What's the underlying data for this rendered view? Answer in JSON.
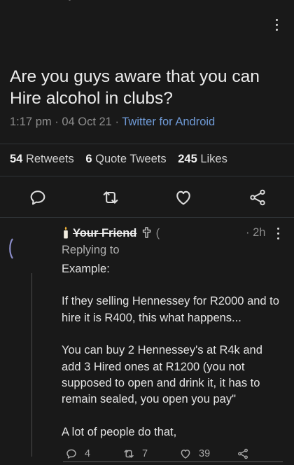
{
  "tweet": {
    "text": "Are you guys aware that you can Hire alcohol in clubs?",
    "time": "1:17 pm",
    "date": "04 Oct 21",
    "source": "Twitter for Android",
    "separator": "·"
  },
  "stats": {
    "retweets_count": "54",
    "retweets_label": "Retweets",
    "quotes_count": "6",
    "quotes_label": "Quote Tweets",
    "likes_count": "245",
    "likes_label": "Likes"
  },
  "icons": {
    "reply": "speech-bubble-icon",
    "retweet": "retweet-icon",
    "like": "heart-icon",
    "share": "share-icon",
    "more": "kebab-menu-icon",
    "candle": "candle-emoji",
    "cross": "cross-emoji"
  },
  "reply": {
    "name": "Your Friend",
    "name_suffix": "(",
    "time": "· 2h",
    "replying_to": "Replying to",
    "paragraphs": [
      "Example:",
      "If they selling Hennessey for R2000 and to hire it is R400, this what happens...",
      "You can buy 2 Hennessey's at R4k and add 3 Hired ones at R1200 (you not supposed to open and drink it, it has to remain sealed, you open you pay\"",
      "A lot of people do that,"
    ],
    "reply_count": "4",
    "retweet_count": "7",
    "like_count": "39"
  },
  "colors": {
    "background": "#191919",
    "link": "#6f9ad6",
    "muted": "#8e8e8e",
    "text": "#e7e7e7"
  }
}
